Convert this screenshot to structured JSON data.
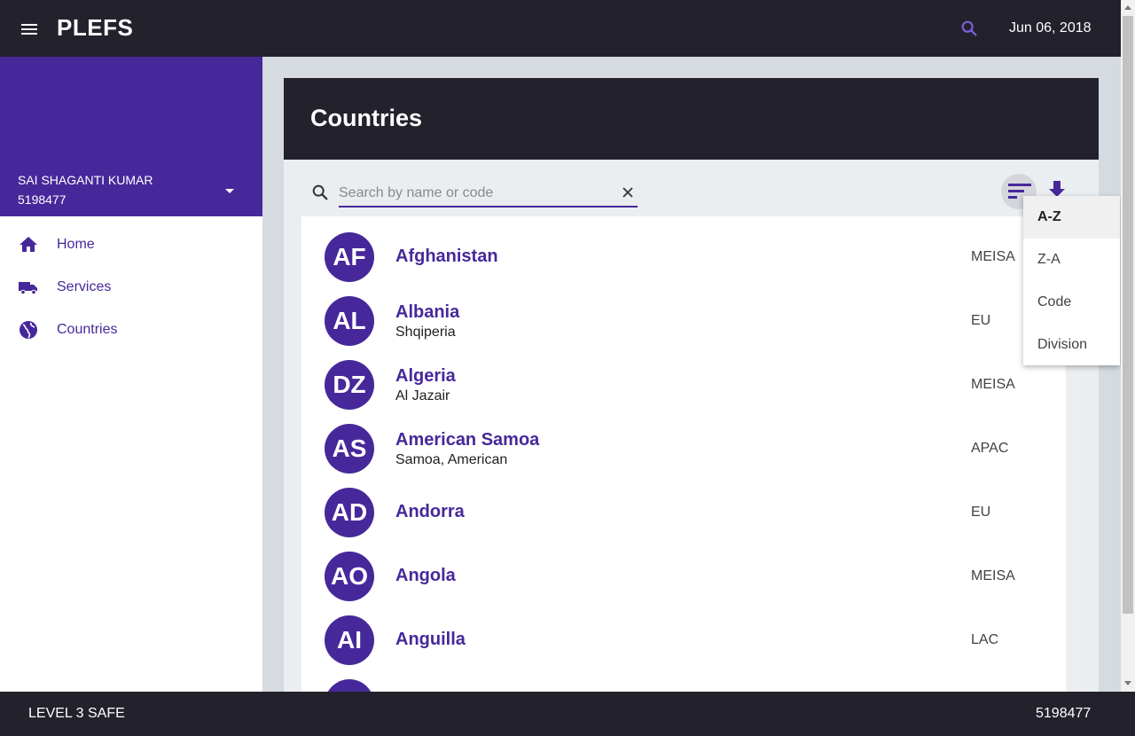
{
  "app": {
    "title": "PLEFS",
    "date": "Jun 06, 2018"
  },
  "sidebar": {
    "user_name": "SAI SHAGANTI KUMAR",
    "user_id": "5198477",
    "items": [
      {
        "label": "Home",
        "icon": "home-icon"
      },
      {
        "label": "Services",
        "icon": "truck-icon"
      },
      {
        "label": "Countries",
        "icon": "globe-icon"
      }
    ]
  },
  "main": {
    "title": "Countries",
    "search": {
      "placeholder": "Search by name or code",
      "value": ""
    },
    "sort_options": [
      "A-Z",
      "Z-A",
      "Code",
      "Division"
    ],
    "selected_sort": "A-Z",
    "countries": [
      {
        "code": "AF",
        "name": "Afghanistan",
        "native": "",
        "division": "MEISA"
      },
      {
        "code": "AL",
        "name": "Albania",
        "native": "Shqiperia",
        "division": "EU"
      },
      {
        "code": "DZ",
        "name": "Algeria",
        "native": "Al Jazair",
        "division": "MEISA"
      },
      {
        "code": "AS",
        "name": "American Samoa",
        "native": "Samoa, American",
        "division": "APAC"
      },
      {
        "code": "AD",
        "name": "Andorra",
        "native": "",
        "division": "EU"
      },
      {
        "code": "AO",
        "name": "Angola",
        "native": "",
        "division": "MEISA"
      },
      {
        "code": "AI",
        "name": "Anguilla",
        "native": "",
        "division": "LAC"
      },
      {
        "code": "",
        "name": "",
        "native": "",
        "division": ""
      }
    ]
  },
  "footer": {
    "left": "LEVEL 3 SAFE",
    "right": "5198477"
  },
  "colors": {
    "primary": "#47289a",
    "dark": "#23212c"
  }
}
